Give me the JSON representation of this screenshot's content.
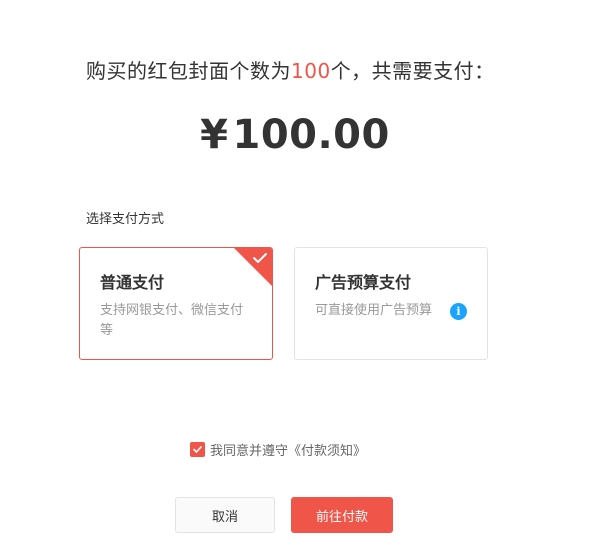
{
  "summary": {
    "prefix": "购买的红包封面个数为",
    "count": "100",
    "suffix": "个，共需要支付："
  },
  "amount": {
    "currency": "¥",
    "value": "100.00"
  },
  "payment": {
    "label": "选择支付方式",
    "options": [
      {
        "title": "普通支付",
        "desc": "支持网银支付、微信支付等",
        "selected": true
      },
      {
        "title": "广告预算支付",
        "desc": "可直接使用广告预算",
        "selected": false
      }
    ]
  },
  "agreement": {
    "checked": true,
    "text": "我同意并遵守",
    "link": "《付款须知》"
  },
  "buttons": {
    "cancel": "取消",
    "pay": "前往付款"
  },
  "colors": {
    "accent": "#f0554a",
    "info": "#1aa4ff",
    "text": "#333333",
    "muted": "#999999"
  }
}
